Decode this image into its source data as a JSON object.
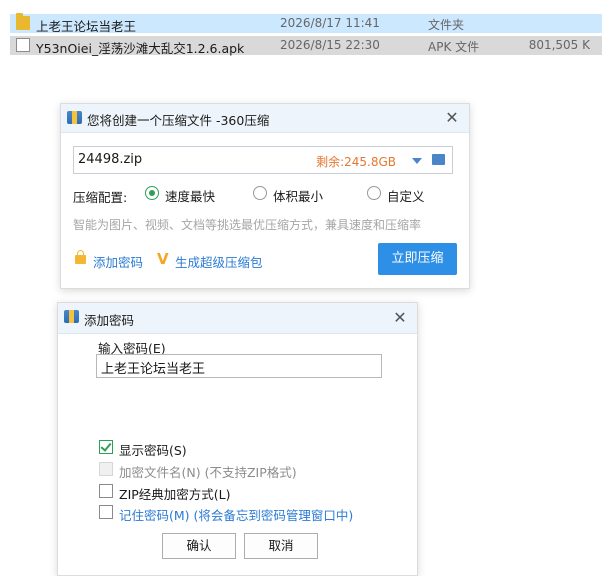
{
  "files": [
    {
      "name": "上老王论坛当老王",
      "date": "2026/8/17 11:41",
      "type": "文件夹",
      "size": "",
      "icon": "folder-icon"
    },
    {
      "name": "Y53nOiei_淫荡沙滩大乱交1.2.6.apk",
      "date": "2026/8/15 22:30",
      "type": "APK 文件",
      "size": "801,505 K",
      "icon": "file-icon"
    }
  ],
  "compress_dialog": {
    "title": "您将创建一个压缩文件 -360压缩",
    "filename": "24498.zip",
    "remaining": "剩余:245.8GB",
    "options_label": "压缩配置:",
    "options": [
      "速度最快",
      "体积最小",
      "自定义"
    ],
    "selected_option": "速度最快",
    "hint": "智能为图片、视频、文档等挑选最优压缩方式，兼具速度和压缩率",
    "add_password": "添加密码",
    "super_compress": "生成超级压缩包",
    "compress_button": "立即压缩"
  },
  "password_dialog": {
    "title": "添加密码",
    "input_label": "输入密码(E)",
    "password_value": "上老王论坛当老王",
    "checkboxes": [
      {
        "label": "显示密码(S)",
        "checked": true,
        "disabled": false
      },
      {
        "label": "加密文件名(N) (不支持ZIP格式)",
        "checked": false,
        "disabled": true
      },
      {
        "label": "ZIP经典加密方式(L)",
        "checked": false,
        "disabled": false
      },
      {
        "label": "记住密码(M) (将会备忘到密码管理窗口中)",
        "checked": false,
        "disabled": false
      }
    ],
    "ok_button": "确认",
    "cancel_button": "取消"
  },
  "colors": {
    "accent": "#2d8fe6",
    "green": "#2e9f58",
    "orange": "#e6772e",
    "link": "#2a7bd4"
  }
}
